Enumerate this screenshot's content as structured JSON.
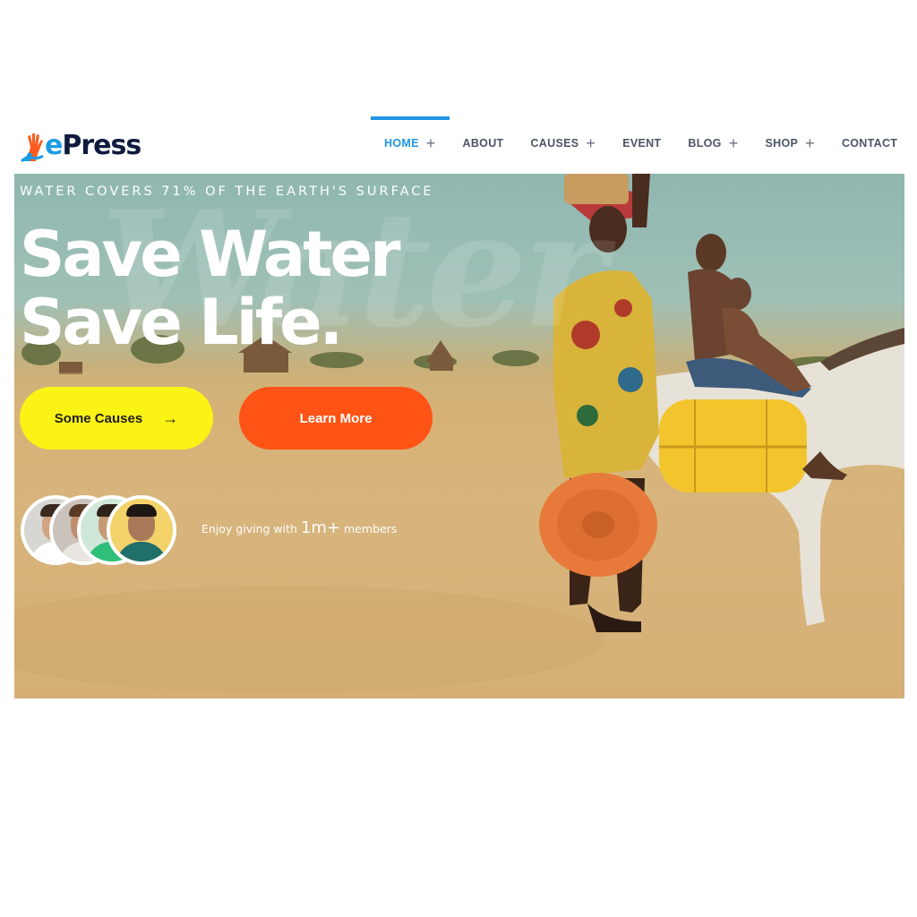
{
  "brand": {
    "logo_first": "e",
    "logo_rest": "Press",
    "colors": {
      "primary": "#2196e6",
      "dark": "#0f1b3d"
    }
  },
  "nav": {
    "items": [
      {
        "label": "HOME",
        "has_submenu": true,
        "active": true
      },
      {
        "label": "ABOUT",
        "has_submenu": false
      },
      {
        "label": "CAUSES",
        "has_submenu": true
      },
      {
        "label": "EVENT",
        "has_submenu": false
      },
      {
        "label": "BLOG",
        "has_submenu": true
      },
      {
        "label": "SHOP",
        "has_submenu": true
      },
      {
        "label": "CONTACT",
        "has_submenu": false
      }
    ],
    "plus_glyph": "+"
  },
  "hero": {
    "eyebrow": "WATER COVERS 71% OF THE EARTH'S SURFACE",
    "watermark": "Water",
    "headline_line1": "Save Water",
    "headline_line2": "Save Life.",
    "primary_button": {
      "label": "Some Causes",
      "icon": "arrow-right-icon",
      "arrow": "→",
      "color": "#fbf315"
    },
    "secondary_button": {
      "label": "Learn More",
      "color": "#ff5416"
    },
    "members_prefix": "Enjoy giving with",
    "members_count": "1m+",
    "members_suffix": "members"
  }
}
